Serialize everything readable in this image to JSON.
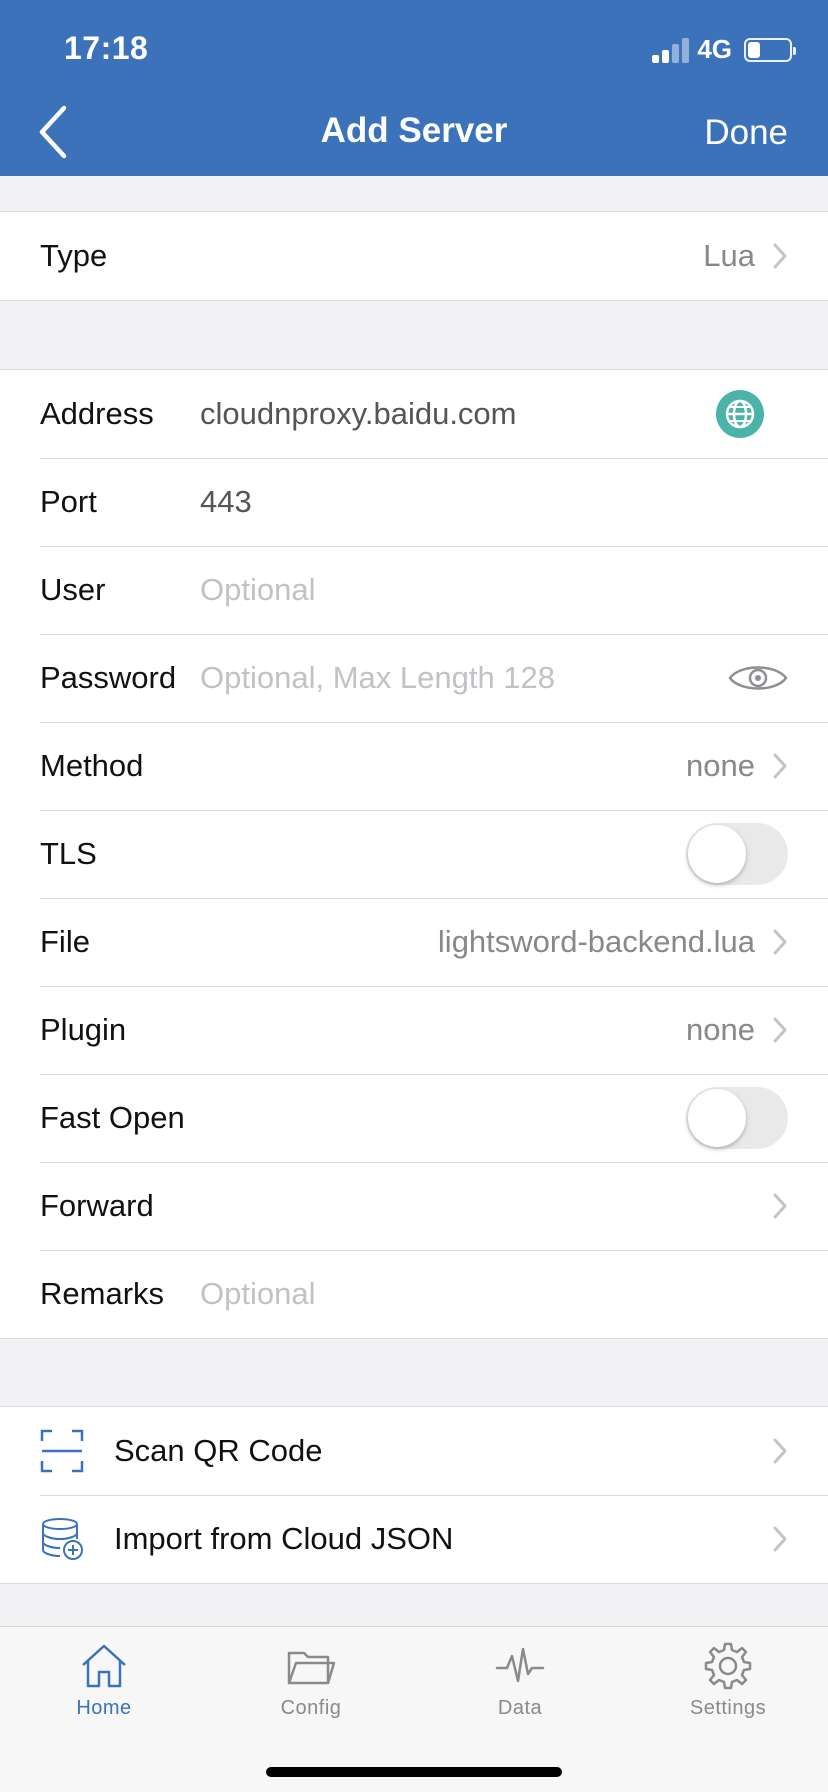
{
  "status": {
    "time": "17:18",
    "network": "4G"
  },
  "nav": {
    "title": "Add Server",
    "done_label": "Done"
  },
  "type_row": {
    "label": "Type",
    "value": "Lua"
  },
  "fields": {
    "address": {
      "label": "Address",
      "value": "cloudnproxy.baidu.com"
    },
    "port": {
      "label": "Port",
      "value": "443"
    },
    "user": {
      "label": "User",
      "placeholder": "Optional"
    },
    "password": {
      "label": "Password",
      "placeholder": "Optional, Max Length 128"
    },
    "method": {
      "label": "Method",
      "value": "none"
    },
    "tls": {
      "label": "TLS",
      "enabled": false
    },
    "file": {
      "label": "File",
      "value": "lightsword-backend.lua"
    },
    "plugin": {
      "label": "Plugin",
      "value": "none"
    },
    "fast_open": {
      "label": "Fast Open",
      "enabled": false
    },
    "forward": {
      "label": "Forward"
    },
    "remarks": {
      "label": "Remarks",
      "placeholder": "Optional"
    }
  },
  "actions": {
    "scan_qr": {
      "label": "Scan QR Code",
      "icon": "qr-scan-icon"
    },
    "import_cloud": {
      "label": "Import from Cloud JSON",
      "icon": "database-add-icon"
    }
  },
  "tabbar": {
    "items": [
      {
        "label": "Home",
        "icon": "home-icon",
        "active": true
      },
      {
        "label": "Config",
        "icon": "folder-icon",
        "active": false
      },
      {
        "label": "Data",
        "icon": "pulse-icon",
        "active": false
      },
      {
        "label": "Settings",
        "icon": "gear-icon",
        "active": false
      }
    ]
  },
  "colors": {
    "accent": "#3b72b9",
    "globe": "#4bb3a8",
    "background": "#f2f2f4",
    "placeholder": "#c2c2c6"
  }
}
